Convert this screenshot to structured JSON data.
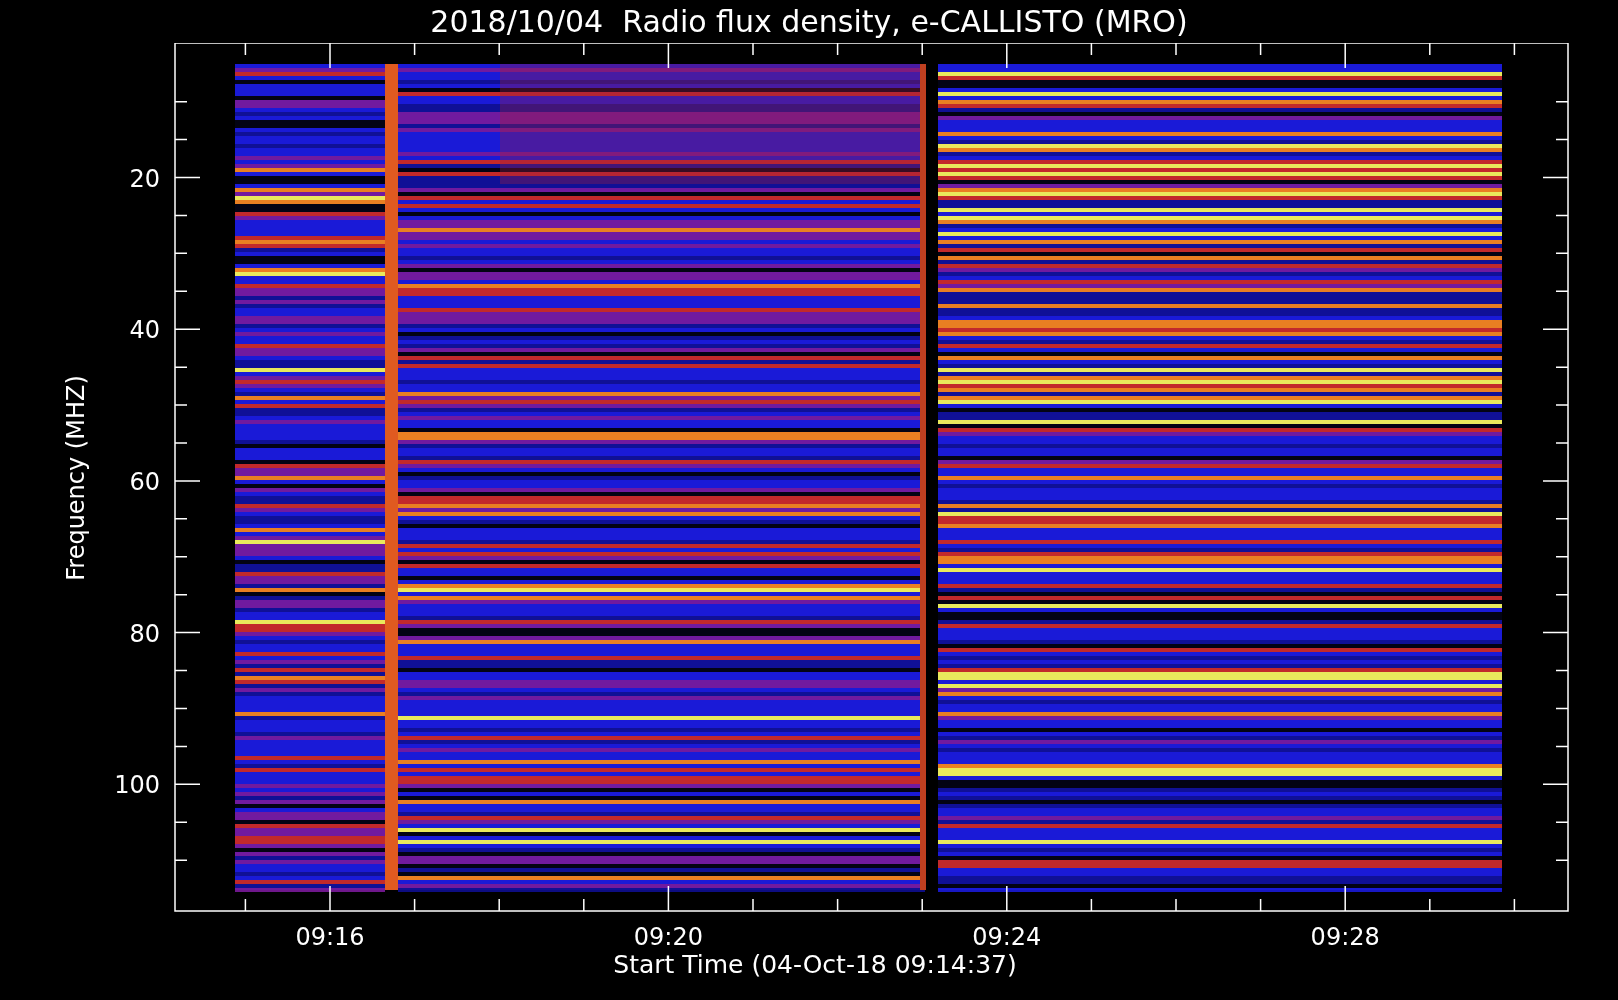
{
  "title": "2018/10/04  Radio flux density, e-CALLISTO (MRO)",
  "plot": {
    "ylabel": "Frequency (MHZ)",
    "xlabel": "Start Time (04-Oct-18 09:14:37)",
    "yticks": [
      "20",
      "40",
      "60",
      "80",
      "100"
    ],
    "xticks": [
      "09:16",
      "09:20",
      "09:24",
      "09:28"
    ]
  }
}
